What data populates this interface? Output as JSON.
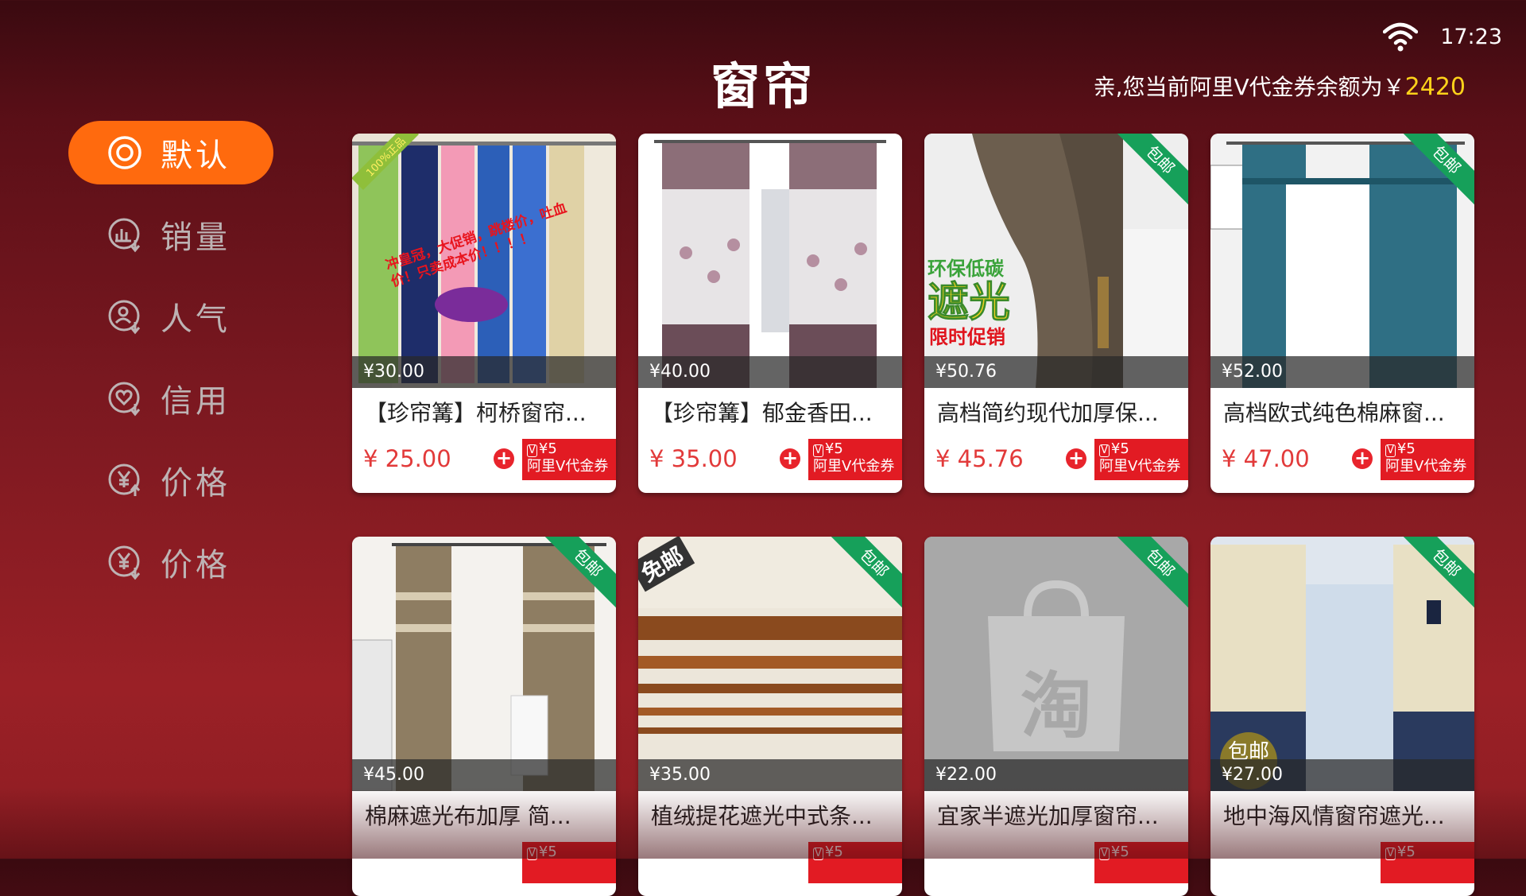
{
  "status": {
    "time": "17:23",
    "wifi_icon": "wifi-icon"
  },
  "header": {
    "title": "窗帘",
    "balance_label": "亲,您当前阿里V代金券余额为￥",
    "balance_amount": "2420"
  },
  "sidebar": {
    "items": [
      {
        "label": "默认",
        "icon": "target-icon",
        "active": true
      },
      {
        "label": "销量",
        "icon": "sales-chart-icon",
        "active": false
      },
      {
        "label": "人气",
        "icon": "user-icon",
        "active": false
      },
      {
        "label": "信用",
        "icon": "heart-icon",
        "active": false
      },
      {
        "label": "价格",
        "icon": "yen-up-icon",
        "active": false
      },
      {
        "label": "价格",
        "icon": "yen-down-icon",
        "active": false
      }
    ]
  },
  "colors": {
    "accent": "#ff6a0e",
    "price": "#e23a3a",
    "coupon": "#e21b23",
    "ribbon": "#16a05a",
    "balance": "#ffd21a"
  },
  "products": [
    {
      "name": "【珍帘篝】柯桥窗帘...",
      "orig_price": "¥30.00",
      "sale_price": "¥ 25.00",
      "coupon_amount": "¥5",
      "coupon_label": "阿里V代金券",
      "badge": "",
      "overlay_top": "100%正品",
      "overlay_text": "冲皇冠，大促销，跳楼价，吐血价！只卖成本价！！！！",
      "overlay_promo": ""
    },
    {
      "name": "【珍帘篝】郁金香田...",
      "orig_price": "¥40.00",
      "sale_price": "¥ 35.00",
      "coupon_amount": "¥5",
      "coupon_label": "阿里V代金券",
      "badge": "",
      "overlay_top": "",
      "overlay_text": "",
      "overlay_promo": ""
    },
    {
      "name": "高档简约现代加厚保...",
      "orig_price": "¥50.76",
      "sale_price": "¥ 45.76",
      "coupon_amount": "¥5",
      "coupon_label": "阿里V代金券",
      "badge": "包邮",
      "overlay_top": "环保低碳",
      "overlay_text": "遮光",
      "overlay_promo": "限时促销"
    },
    {
      "name": "高档欧式纯色棉麻窗...",
      "orig_price": "¥52.00",
      "sale_price": "¥ 47.00",
      "coupon_amount": "¥5",
      "coupon_label": "阿里V代金券",
      "badge": "包邮",
      "overlay_top": "",
      "overlay_text": "",
      "overlay_promo": ""
    },
    {
      "name": "棉麻遮光布加厚 简...",
      "orig_price": "¥45.00",
      "sale_price": "",
      "coupon_amount": "¥5",
      "coupon_label": "",
      "badge": "包邮",
      "overlay_top": "",
      "overlay_text": "",
      "overlay_promo": ""
    },
    {
      "name": "植绒提花遮光中式条...",
      "orig_price": "¥35.00",
      "sale_price": "",
      "coupon_amount": "¥5",
      "coupon_label": "",
      "badge": "包邮",
      "overlay_top": "免邮",
      "overlay_text": "",
      "overlay_promo": ""
    },
    {
      "name": "宜家半遮光加厚窗帘...",
      "orig_price": "¥22.00",
      "sale_price": "",
      "coupon_amount": "¥5",
      "coupon_label": "",
      "badge": "包邮",
      "overlay_top": "淘",
      "overlay_text": "",
      "overlay_promo": ""
    },
    {
      "name": "地中海风情窗帘遮光...",
      "orig_price": "¥27.00",
      "sale_price": "",
      "coupon_amount": "¥5",
      "coupon_label": "",
      "badge": "包邮",
      "overlay_top": "包邮",
      "overlay_text": "",
      "overlay_promo": ""
    }
  ]
}
